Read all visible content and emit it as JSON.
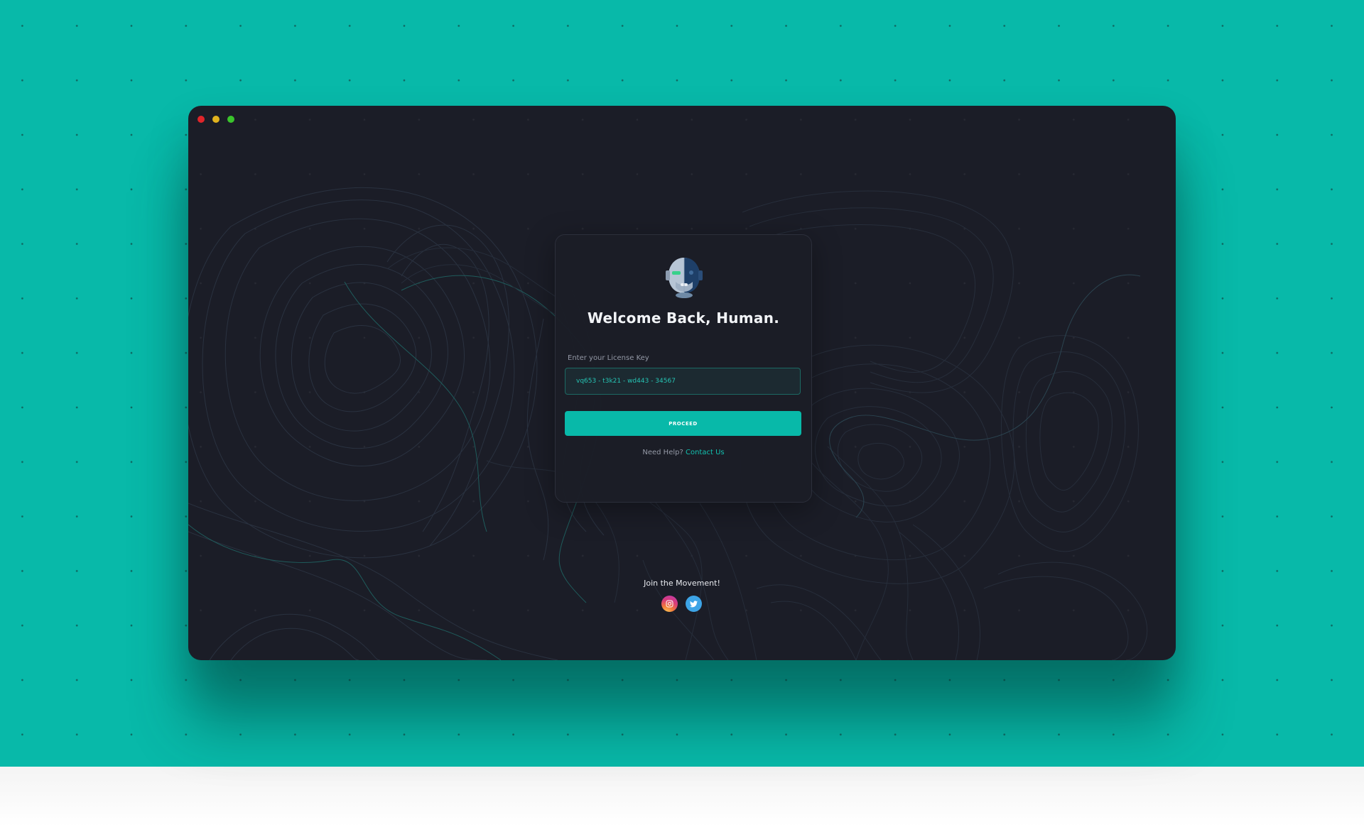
{
  "window": {
    "controls": [
      "close",
      "minimize",
      "maximize"
    ]
  },
  "login": {
    "avatar_icon": "robot-head-icon",
    "title": "Welcome Back, Human.",
    "license_label": "Enter your License Key",
    "license_value": "vq653 - t3k21 - wd443 - 34567",
    "proceed_label": "PROCEED",
    "help_text": "Need Help?",
    "help_link": "Contact Us"
  },
  "footer": {
    "join_text": "Join the Movement!",
    "social": [
      {
        "name": "instagram",
        "icon": "instagram-icon"
      },
      {
        "name": "twitter",
        "icon": "twitter-icon"
      }
    ]
  },
  "colors": {
    "accent": "#08b9a9",
    "window_bg": "#1b1d27",
    "link": "#12c0af"
  }
}
